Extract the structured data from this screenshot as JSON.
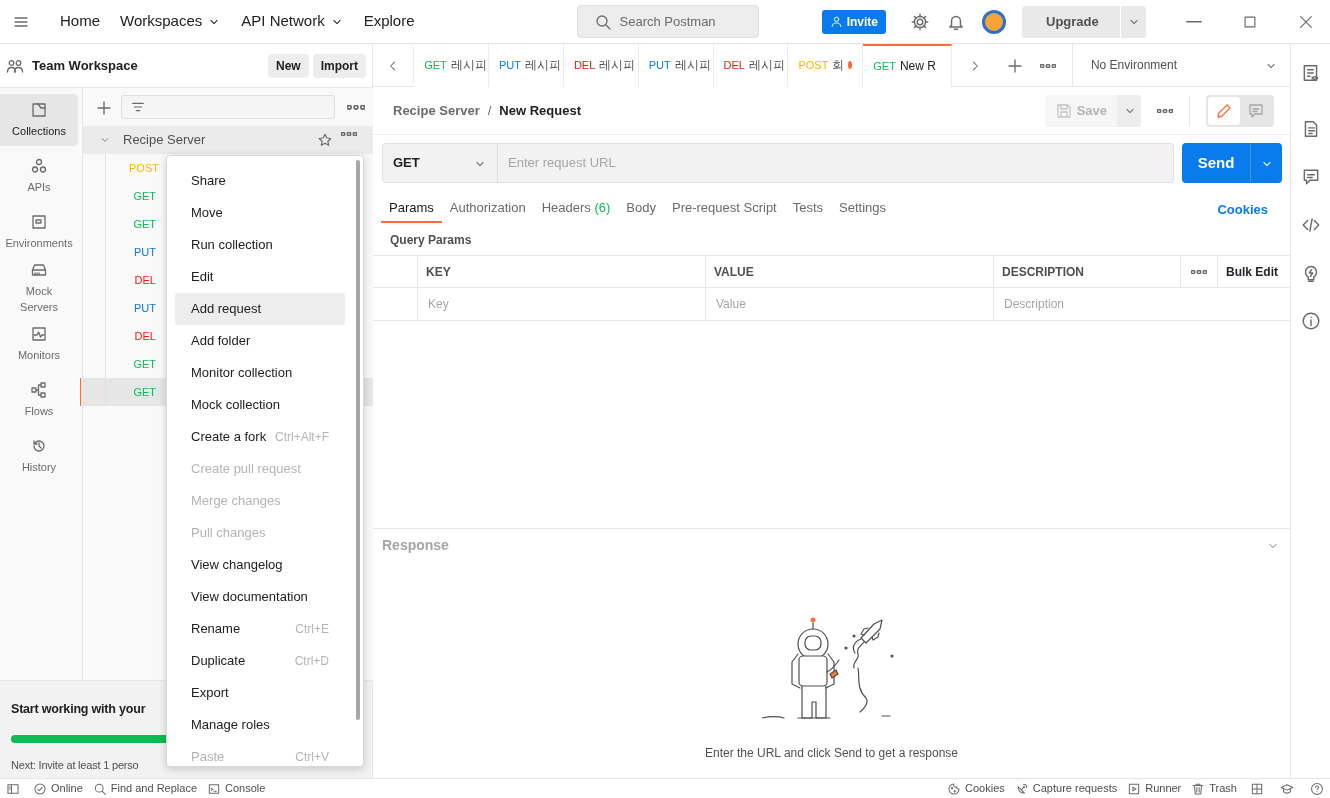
{
  "topbar": {
    "nav": [
      {
        "label": "Home",
        "dropdown": false
      },
      {
        "label": "Workspaces",
        "dropdown": true
      },
      {
        "label": "API Network",
        "dropdown": true
      },
      {
        "label": "Explore",
        "dropdown": false
      }
    ],
    "search": {
      "placeholder": "Search Postman"
    },
    "invite": "Invite",
    "upgrade": "Upgrade"
  },
  "workspace": {
    "title": "Team Workspace",
    "buttons": [
      "New",
      "Import"
    ]
  },
  "rail": [
    {
      "label": "Collections",
      "kind": "collections",
      "selected": true
    },
    {
      "label": "APIs",
      "kind": "apis",
      "selected": false
    },
    {
      "label": "Environments",
      "kind": "environments",
      "selected": false
    },
    {
      "label": "Mock Servers",
      "kind": "mock",
      "selected": false
    },
    {
      "label": "Monitors",
      "kind": "monitors",
      "selected": false
    },
    {
      "label": "Flows",
      "kind": "flows",
      "selected": false
    },
    {
      "label": "History",
      "kind": "history",
      "selected": false
    }
  ],
  "tree": {
    "collection": {
      "name": "Recipe Server",
      "expanded": true
    },
    "requests": [
      {
        "method": "POST",
        "color": "#ffb400",
        "selected": false
      },
      {
        "method": "GET",
        "color": "#0cbb52",
        "selected": false
      },
      {
        "method": "GET",
        "color": "#0cbb52",
        "selected": false
      },
      {
        "method": "PUT",
        "color": "#097bed",
        "selected": false
      },
      {
        "method": "DEL",
        "color": "#eb2013",
        "selected": false
      },
      {
        "method": "PUT",
        "color": "#097bed",
        "selected": false
      },
      {
        "method": "DEL",
        "color": "#eb2013",
        "selected": false
      },
      {
        "method": "GET",
        "color": "#0cbb52",
        "selected": false
      },
      {
        "method": "GET",
        "color": "#0cbb52",
        "selected": true
      }
    ]
  },
  "context_menu": [
    {
      "label": "Share",
      "disabled": false,
      "selected": false
    },
    {
      "label": "Move",
      "disabled": false,
      "selected": false
    },
    {
      "label": "Run collection",
      "disabled": false,
      "selected": false
    },
    {
      "label": "Edit",
      "disabled": false,
      "selected": false
    },
    {
      "label": "Add request",
      "disabled": false,
      "selected": true
    },
    {
      "label": "Add folder",
      "disabled": false,
      "selected": false
    },
    {
      "label": "Monitor collection",
      "disabled": false,
      "selected": false
    },
    {
      "label": "Mock collection",
      "disabled": false,
      "selected": false
    },
    {
      "label": "Create a fork",
      "shortcut": "Ctrl+Alt+F",
      "disabled": false,
      "selected": false
    },
    {
      "label": "Create pull request",
      "disabled": true,
      "selected": false
    },
    {
      "label": "Merge changes",
      "disabled": true,
      "selected": false
    },
    {
      "label": "Pull changes",
      "disabled": true,
      "selected": false
    },
    {
      "label": "View changelog",
      "disabled": false,
      "selected": false
    },
    {
      "label": "View documentation",
      "disabled": false,
      "selected": false
    },
    {
      "label": "Rename",
      "shortcut": "Ctrl+E",
      "disabled": false,
      "selected": false
    },
    {
      "label": "Duplicate",
      "shortcut": "Ctrl+D",
      "disabled": false,
      "selected": false
    },
    {
      "label": "Export",
      "disabled": false,
      "selected": false
    },
    {
      "label": "Manage roles",
      "disabled": false,
      "selected": false
    },
    {
      "label": "Paste",
      "shortcut": "Ctrl+V",
      "disabled": true,
      "selected": false
    }
  ],
  "onboarding": {
    "title": "Start working with your",
    "level": 0.8,
    "next": "Next: Invite at least 1 perso"
  },
  "tabs": [
    {
      "method": "GET",
      "color": "#0cbb52",
      "name": "레시피",
      "selected": false,
      "unsaved": false
    },
    {
      "method": "PUT",
      "color": "#097bed",
      "name": "레시피",
      "selected": false,
      "unsaved": false
    },
    {
      "method": "DEL",
      "color": "#eb2013",
      "name": "레시피",
      "selected": false,
      "unsaved": false
    },
    {
      "method": "PUT",
      "color": "#097bed",
      "name": "레시피",
      "selected": false,
      "unsaved": false
    },
    {
      "method": "DEL",
      "color": "#eb2013",
      "name": "레시피",
      "selected": false,
      "unsaved": false
    },
    {
      "method": "POST",
      "color": "#ffb400",
      "name": "회",
      "selected": false,
      "unsaved": true
    },
    {
      "method": "GET",
      "color": "#0cbb52",
      "name": "New R",
      "selected": true,
      "unsaved": false
    }
  ],
  "environment": "No Environment",
  "breadcrumb": [
    "Recipe Server",
    "New Request"
  ],
  "breadcrumb_separator": "/",
  "save": {
    "label": "Save",
    "disabled": true
  },
  "request": {
    "method": "GET",
    "url_placeholder": "Enter request URL",
    "send": "Send"
  },
  "request_tabs": [
    {
      "label": "Params",
      "selected": true
    },
    {
      "label": "Authorization",
      "selected": false
    },
    {
      "label": "Headers",
      "count": "(6)",
      "selected": false
    },
    {
      "label": "Body",
      "selected": false
    },
    {
      "label": "Pre-request Script",
      "selected": false
    },
    {
      "label": "Tests",
      "selected": false
    },
    {
      "label": "Settings",
      "selected": false
    }
  ],
  "cookies": "Cookies",
  "query_params": {
    "title": "Query Params",
    "columns": [
      "KEY",
      "VALUE",
      "DESCRIPTION"
    ],
    "bulk_edit": "Bulk Edit",
    "placeholders": [
      "Key",
      "Value",
      "Description"
    ]
  },
  "response": {
    "title": "Response",
    "empty_text": "Enter the URL and click Send to get a response"
  },
  "status_bar": {
    "left": [
      {
        "label": "Online",
        "kind": "online"
      },
      {
        "label": "Find and Replace",
        "kind": "find"
      },
      {
        "label": "Console",
        "kind": "console"
      }
    ],
    "right": [
      {
        "label": "Cookies",
        "kind": "cookies"
      },
      {
        "label": "Capture requests",
        "kind": "capture"
      },
      {
        "label": "Runner",
        "kind": "runner"
      },
      {
        "label": "Trash",
        "kind": "trash"
      }
    ]
  }
}
